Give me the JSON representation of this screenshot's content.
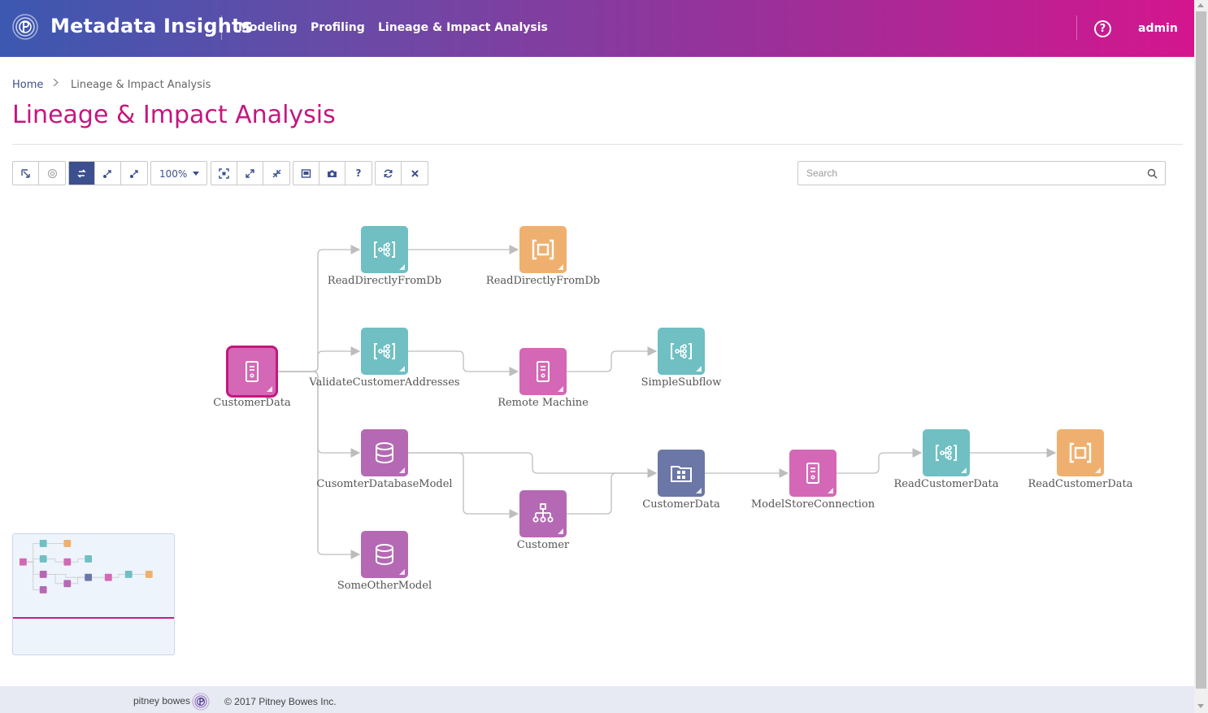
{
  "header": {
    "app_title": "Metadata Insights",
    "nav": [
      {
        "label": "Modeling"
      },
      {
        "label": "Profiling"
      },
      {
        "label": "Lineage & Impact Analysis"
      }
    ],
    "help_label": "?",
    "user": "admin"
  },
  "breadcrumb": {
    "home": "Home",
    "current": "Lineage & Impact Analysis"
  },
  "page_title": "Lineage & Impact Analysis",
  "toolbar": {
    "zoom": "100%",
    "help_label": "?"
  },
  "search": {
    "placeholder": "Search",
    "value": ""
  },
  "graph": {
    "colors": {
      "dataflow": "#6fbfc3",
      "stage": "#efb06f",
      "server": "#d468b6",
      "model": "#b569b4",
      "physical": "#6b77a6",
      "edge": "#bdbdbd",
      "selected": "#c4177f"
    },
    "nodes": [
      {
        "id": "customerdata-src",
        "label": "CustomerData",
        "type": "server",
        "icon": "server-icon",
        "selected": true
      },
      {
        "id": "readdirect-flow",
        "label": "ReadDirectlyFromDb",
        "type": "dataflow",
        "icon": "dataflow-icon"
      },
      {
        "id": "readdirect-stage",
        "label": "ReadDirectlyFromDb",
        "type": "stage",
        "icon": "stage-icon"
      },
      {
        "id": "validate-flow",
        "label": "ValidateCustomerAddresses",
        "type": "dataflow",
        "icon": "dataflow-icon"
      },
      {
        "id": "remote-machine",
        "label": "Remote Machine",
        "type": "server",
        "icon": "server-icon"
      },
      {
        "id": "simple-subflow",
        "label": "SimpleSubflow",
        "type": "dataflow",
        "icon": "dataflow-icon"
      },
      {
        "id": "cusomter-db-model",
        "label": "CusomterDatabaseModel",
        "type": "model",
        "icon": "database-icon"
      },
      {
        "id": "customer-model",
        "label": "Customer",
        "type": "model",
        "icon": "hierarchy-icon"
      },
      {
        "id": "customerdata-phys",
        "label": "CustomerData",
        "type": "physical",
        "icon": "folder-grid-icon"
      },
      {
        "id": "modelstore-conn",
        "label": "ModelStoreConnection",
        "type": "server",
        "icon": "server-icon"
      },
      {
        "id": "readcustomer-flow",
        "label": "ReadCustomerData",
        "type": "dataflow",
        "icon": "dataflow-icon"
      },
      {
        "id": "readcustomer-stage",
        "label": "ReadCustomerData",
        "type": "stage",
        "icon": "stage-icon"
      },
      {
        "id": "someother-model",
        "label": "SomeOtherModel",
        "type": "model",
        "icon": "database-icon"
      }
    ],
    "edges": [
      [
        "customerdata-src",
        "readdirect-flow"
      ],
      [
        "customerdata-src",
        "validate-flow"
      ],
      [
        "customerdata-src",
        "cusomter-db-model"
      ],
      [
        "customerdata-src",
        "someother-model"
      ],
      [
        "readdirect-flow",
        "readdirect-stage"
      ],
      [
        "validate-flow",
        "remote-machine"
      ],
      [
        "remote-machine",
        "simple-subflow"
      ],
      [
        "cusomter-db-model",
        "customer-model"
      ],
      [
        "cusomter-db-model",
        "customerdata-phys"
      ],
      [
        "customer-model",
        "customerdata-phys"
      ],
      [
        "customerdata-phys",
        "modelstore-conn"
      ],
      [
        "modelstore-conn",
        "readcustomer-flow"
      ],
      [
        "readcustomer-flow",
        "readcustomer-stage"
      ]
    ]
  },
  "footer": {
    "brand": "pitney bowes",
    "copyright": "© 2017 Pitney Bowes Inc."
  }
}
